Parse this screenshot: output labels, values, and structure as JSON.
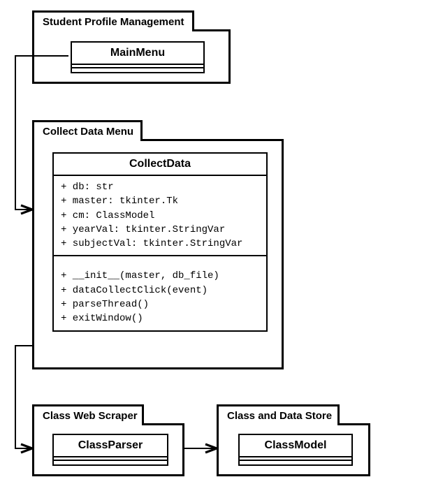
{
  "packages": {
    "spm": {
      "title": "Student Profile Management"
    },
    "cdm": {
      "title": "Collect Data Menu"
    },
    "cws": {
      "title": "Class Web Scraper"
    },
    "cds": {
      "title": "Class and Data Store"
    }
  },
  "classes": {
    "mainmenu": {
      "name": "MainMenu"
    },
    "collectdata": {
      "name": "CollectData",
      "attrs": [
        "+ db: str",
        "+ master: tkinter.Tk",
        "+ cm: ClassModel",
        "+ yearVal: tkinter.StringVar",
        "+ subjectVal: tkinter.StringVar"
      ],
      "methods": [
        "+ __init__(master, db_file)",
        "+ dataCollectClick(event)",
        "+ parseThread()",
        "+ exitWindow()"
      ]
    },
    "classparser": {
      "name": "ClassParser"
    },
    "classmodel": {
      "name": "ClassModel"
    }
  }
}
